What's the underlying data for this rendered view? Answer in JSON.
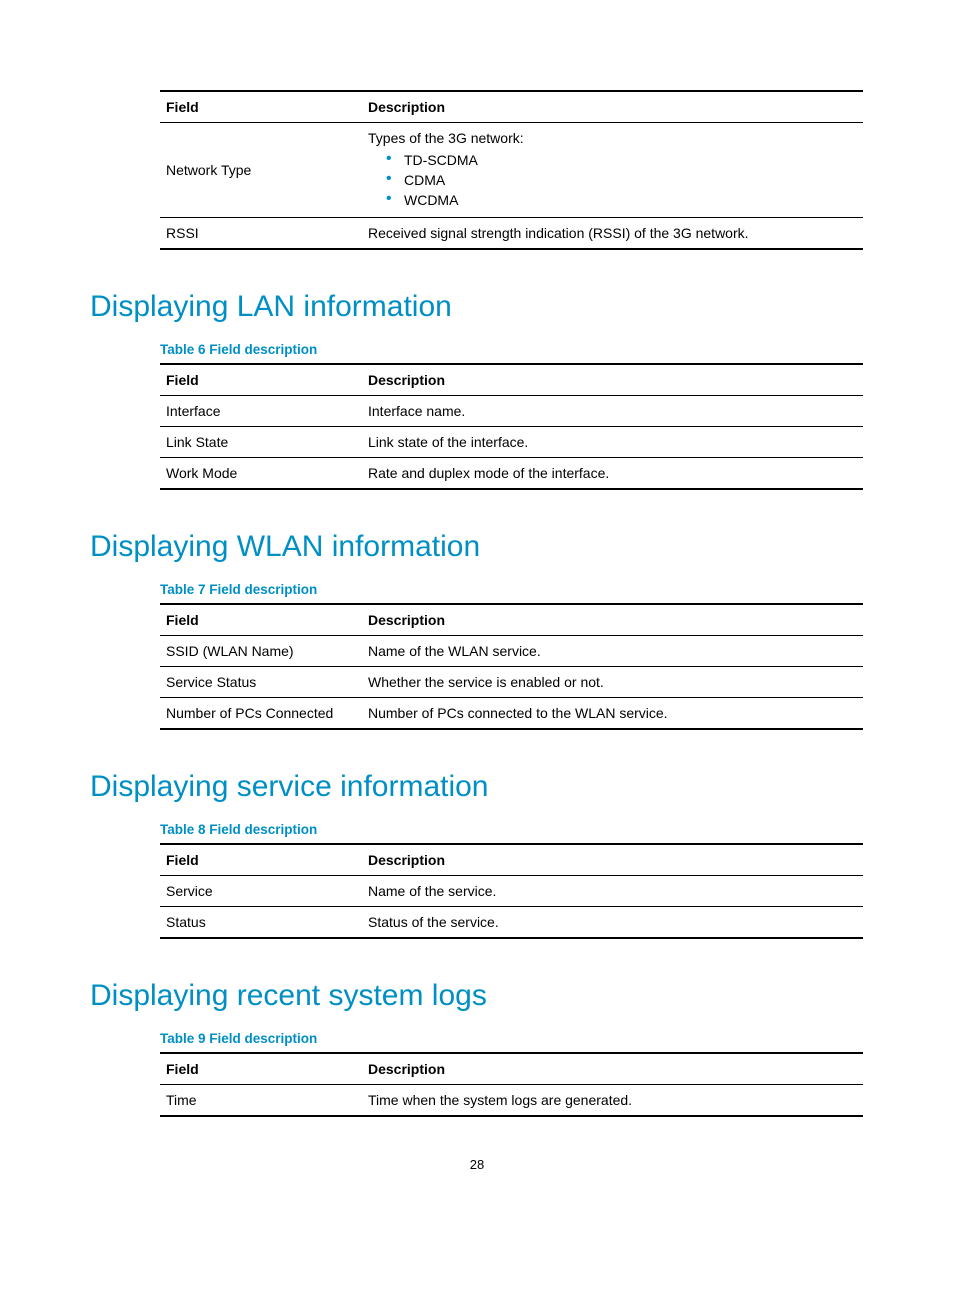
{
  "topTable": {
    "headers": {
      "field": "Field",
      "description": "Description"
    },
    "rows": [
      {
        "field": "Network Type",
        "descIntro": "Types of the 3G network:",
        "bullets": [
          "TD-SCDMA",
          "CDMA",
          "WCDMA"
        ]
      },
      {
        "field": "RSSI",
        "desc": "Received signal strength indication (RSSI) of the 3G network."
      }
    ]
  },
  "sections": [
    {
      "heading": "Displaying LAN information",
      "caption": "Table 6 Field description",
      "headers": {
        "field": "Field",
        "description": "Description"
      },
      "rows": [
        {
          "field": "Interface",
          "desc": "Interface name."
        },
        {
          "field": "Link State",
          "desc": "Link state of the interface."
        },
        {
          "field": "Work Mode",
          "desc": "Rate and duplex mode of the interface."
        }
      ]
    },
    {
      "heading": "Displaying WLAN information",
      "caption": "Table 7 Field description",
      "headers": {
        "field": "Field",
        "description": "Description"
      },
      "rows": [
        {
          "field": "SSID (WLAN Name)",
          "desc": "Name of the WLAN service."
        },
        {
          "field": "Service Status",
          "desc": "Whether the service is enabled or not."
        },
        {
          "field": "Number of PCs Connected",
          "desc": "Number of PCs connected to the WLAN service."
        }
      ]
    },
    {
      "heading": "Displaying service information",
      "caption": "Table 8 Field description",
      "headers": {
        "field": "Field",
        "description": "Description"
      },
      "rows": [
        {
          "field": "Service",
          "desc": "Name of the service."
        },
        {
          "field": "Status",
          "desc": "Status of the service."
        }
      ]
    },
    {
      "heading": "Displaying recent system logs",
      "caption": "Table 9 Field description",
      "headers": {
        "field": "Field",
        "description": "Description"
      },
      "rows": [
        {
          "field": "Time",
          "desc": "Time when the system logs are generated."
        }
      ]
    }
  ],
  "pageNumber": "28"
}
